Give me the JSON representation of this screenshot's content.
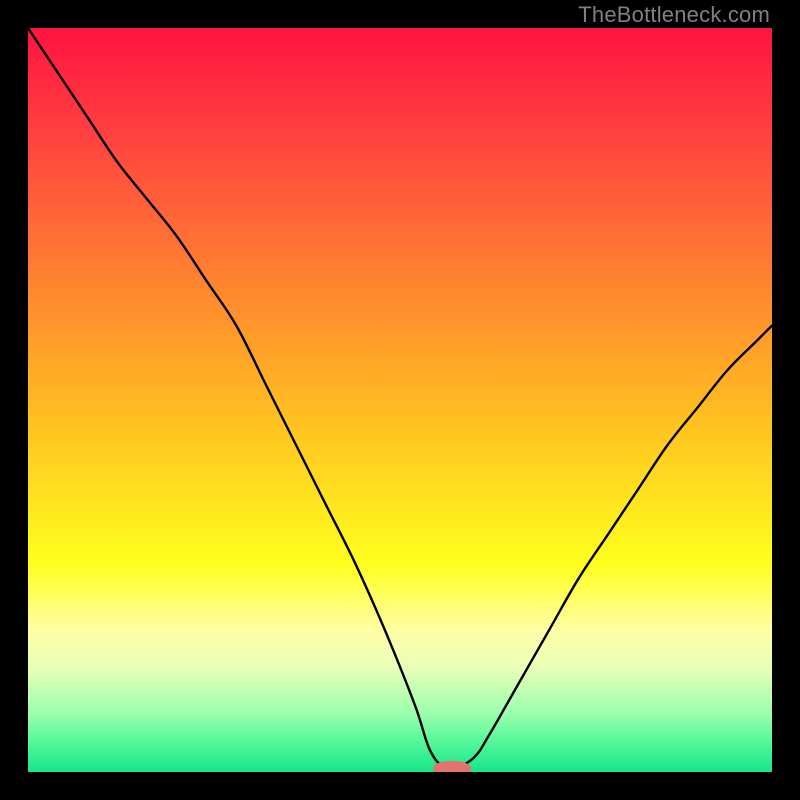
{
  "watermark": "TheBottleneck.com",
  "colors": {
    "frame": "#000000",
    "text": "#808080",
    "curve": "#000000",
    "marker": "#E4736F",
    "gradient_stops": [
      {
        "pct": 0,
        "color": "#FF1341"
      },
      {
        "pct": 14,
        "color": "#FF4040"
      },
      {
        "pct": 36,
        "color": "#FF8A2E"
      },
      {
        "pct": 55,
        "color": "#FFC820"
      },
      {
        "pct": 72,
        "color": "#FFFF1E"
      },
      {
        "pct": 81,
        "color": "#FFFFA6"
      },
      {
        "pct": 86,
        "color": "#E8FFB8"
      },
      {
        "pct": 92,
        "color": "#9CFFAE"
      },
      {
        "pct": 96,
        "color": "#54F79A"
      },
      {
        "pct": 100,
        "color": "#18E58A"
      }
    ]
  },
  "chart_data": {
    "type": "line",
    "title": "",
    "xlabel": "",
    "ylabel": "",
    "xlim": [
      0,
      100
    ],
    "ylim": [
      0,
      100
    ],
    "x": [
      0,
      4,
      8,
      12,
      16,
      20,
      24,
      28,
      32,
      36,
      40,
      44,
      48,
      52,
      54,
      56,
      57.5,
      60,
      62,
      66,
      70,
      74,
      78,
      82,
      86,
      90,
      94,
      98,
      100
    ],
    "values": [
      100,
      94,
      88,
      82,
      77,
      72,
      66,
      60,
      52,
      44,
      36,
      28,
      19,
      9,
      3,
      0.5,
      0.5,
      2,
      5,
      12,
      19,
      26,
      32,
      38,
      44,
      49,
      54,
      58,
      60
    ],
    "marker": {
      "x": 57,
      "y": 0.5,
      "rx": 2.6,
      "ry": 1.0
    },
    "notes": "Y is bottleneck percent (high=red, low=green). Curve is approximate read-off of the black V-shaped line; minimum plateau near x≈55–58."
  }
}
